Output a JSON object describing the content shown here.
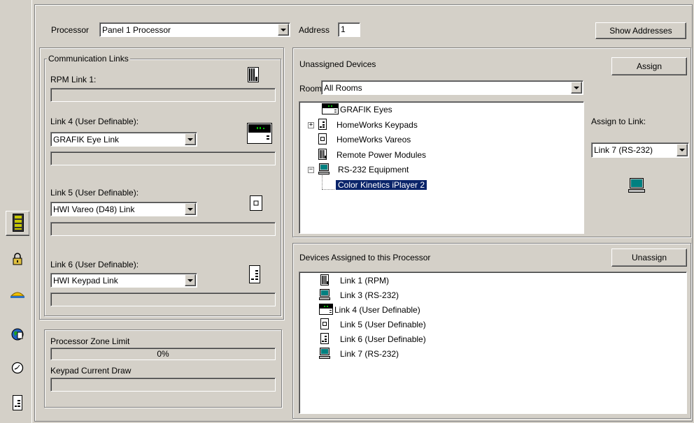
{
  "header": {
    "processor_label": "Processor",
    "processor_value": "Panel 1 Processor",
    "address_label": "Address",
    "address_value": "1",
    "show_addresses_label": "Show Addresses"
  },
  "comm": {
    "group_title": "Communication Links",
    "rpm_label": "RPM Link 1:",
    "link4_label": "Link 4 (User Definable):",
    "link4_value": "GRAFIK Eye Link",
    "link5_label": "Link 5 (User Definable):",
    "link5_value": "HWI Vareo (D48) Link",
    "link6_label": "Link 6 (User Definable):",
    "link6_value": "HWI Keypad Link"
  },
  "limits": {
    "zone_limit_label": "Processor Zone Limit",
    "zone_limit_text": "0%",
    "zone_limit_percent": 0,
    "keypad_draw_label": "Keypad Current Draw",
    "keypad_draw_percent": 0
  },
  "unassigned": {
    "title": "Unassigned Devices",
    "assign_label": "Assign",
    "room_label": "Room",
    "room_value": "All Rooms",
    "assign_to_link_label": "Assign to Link:",
    "assign_to_link_value": "Link 7 (RS-232)",
    "tree": [
      {
        "label": "GRAFIK Eyes",
        "icon": "grafik-eye-icon"
      },
      {
        "label": "HomeWorks Keypads",
        "icon": "keypad-icon",
        "expander": "+"
      },
      {
        "label": "HomeWorks Vareos",
        "icon": "vareo-icon"
      },
      {
        "label": "Remote Power Modules",
        "icon": "rpm-icon"
      },
      {
        "label": "RS-232 Equipment",
        "icon": "computer-icon",
        "expander": "−"
      },
      {
        "label": "Color Kinetics iPlayer 2",
        "selected": true
      }
    ]
  },
  "assigned": {
    "title": "Devices Assigned to this Processor",
    "unassign_label": "Unassign",
    "items": [
      {
        "label": "Link 1 (RPM)",
        "icon": "rpm-icon"
      },
      {
        "label": "Link 3 (RS-232)",
        "icon": "computer-icon"
      },
      {
        "label": "Link 4 (User Definable)",
        "icon": "grafik-eye-icon"
      },
      {
        "label": "Link 5 (User Definable)",
        "icon": "vareo-icon"
      },
      {
        "label": "Link 6 (User Definable)",
        "icon": "keypad-icon"
      },
      {
        "label": "Link 7 (RS-232)",
        "icon": "computer-icon"
      }
    ]
  },
  "sidebar": {
    "tabs": [
      {
        "icon": "processor-panel-icon",
        "active": true
      },
      {
        "icon": "lock-icon"
      },
      {
        "icon": "sun-icon"
      },
      {
        "icon": "globe-icon"
      },
      {
        "icon": "clock-icon"
      },
      {
        "icon": "keypad-icon"
      }
    ]
  },
  "colors": {
    "face": "#d4d0c8",
    "selection": "#0a246a",
    "grafik_green": "#00c000",
    "computer_teal": "#008080"
  }
}
